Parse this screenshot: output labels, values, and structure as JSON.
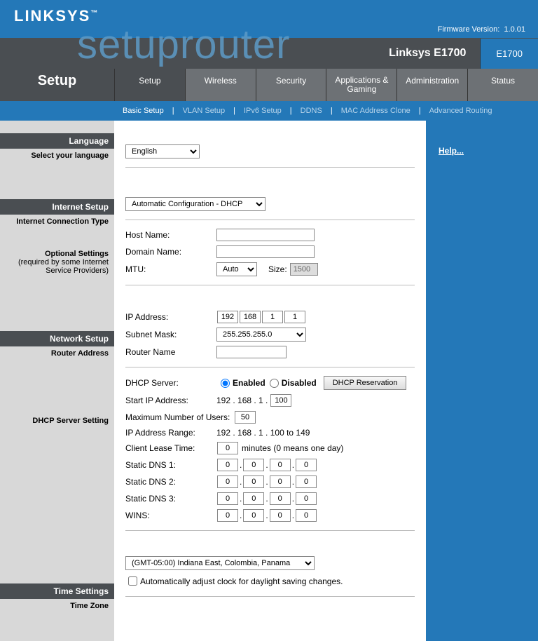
{
  "header": {
    "brand": "LINKSYS",
    "firmware_label": "Firmware Version:",
    "firmware_version": "1.0.01",
    "model_name": "Linksys E1700",
    "model_number": "E1700"
  },
  "watermark": "setuprouter",
  "nav": {
    "page_title": "Setup",
    "tabs": [
      "Setup",
      "Wireless",
      "Security",
      "Applications & Gaming",
      "Administration",
      "Status"
    ],
    "subnav": [
      "Basic Setup",
      "VLAN Setup",
      "IPv6 Setup",
      "DDNS",
      "MAC Address Clone",
      "Advanced Routing"
    ]
  },
  "help_link": "Help...",
  "sections": {
    "language": {
      "heading": "Language",
      "sublabel": "Select your language",
      "value": "English"
    },
    "internet": {
      "heading": "Internet Setup",
      "type_label": "Internet Connection Type",
      "type_value": "Automatic Configuration - DHCP"
    },
    "optional": {
      "heading1": "Optional Settings",
      "heading2": "(required by some Internet Service Providers)",
      "host_label": "Host Name:",
      "host_value": "",
      "domain_label": "Domain Name:",
      "domain_value": "",
      "mtu_label": "MTU:",
      "mtu_mode": "Auto",
      "size_label": "Size:",
      "size_value": "1500"
    },
    "network": {
      "heading": "Network Setup",
      "router_addr_label": "Router Address",
      "ip_label": "IP Address:",
      "ip": [
        "192",
        "168",
        "1",
        "1"
      ],
      "mask_label": "Subnet Mask:",
      "mask_value": "255.255.255.0",
      "router_name_label": "Router Name",
      "router_name_value": ""
    },
    "dhcp": {
      "heading": "DHCP Server Setting",
      "server_label": "DHCP Server:",
      "enabled_label": "Enabled",
      "disabled_label": "Disabled",
      "reservation_btn": "DHCP Reservation",
      "start_ip_label": "Start IP Address:",
      "start_ip_prefix": "192 . 168 . 1 .",
      "start_ip_last": "100",
      "max_users_label": "Maximum Number of Users:",
      "max_users_value": "50",
      "range_label": "IP Address Range:",
      "range_value": "192 . 168 . 1 . 100 to 149",
      "lease_label": "Client Lease Time:",
      "lease_value": "0",
      "lease_suffix": "minutes (0 means one day)",
      "dns1_label": "Static DNS 1:",
      "dns2_label": "Static DNS 2:",
      "dns3_label": "Static DNS 3:",
      "wins_label": "WINS:",
      "quad_zero": [
        "0",
        "0",
        "0",
        "0"
      ]
    },
    "time": {
      "heading": "Time Settings",
      "tz_label": "Time Zone",
      "tz_value": "(GMT-05:00) Indiana East, Colombia, Panama",
      "dst_label": "Automatically adjust clock for daylight saving changes."
    }
  }
}
